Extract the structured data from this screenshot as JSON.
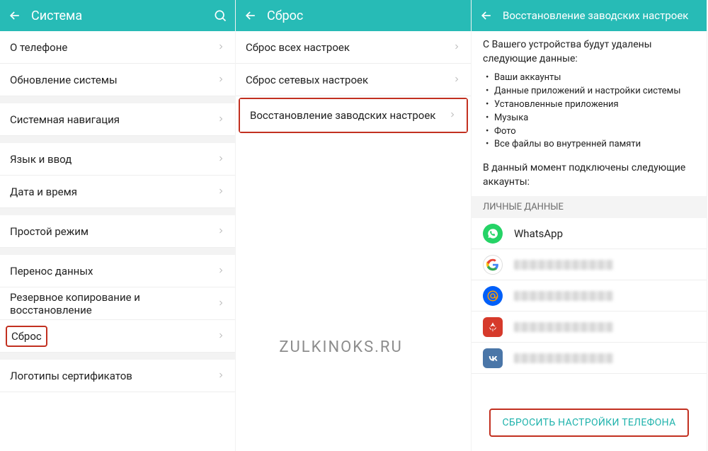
{
  "watermark": "ZULKINOKS.RU",
  "panel1": {
    "title": "Система",
    "groups": [
      [
        "О телефоне",
        "Обновление системы"
      ],
      [
        "Системная навигация"
      ],
      [
        "Язык и ввод",
        "Дата и время"
      ],
      [
        "Простой режим"
      ],
      [
        "Перенос данных",
        "Резервное копирование и восстановление",
        "Сброс"
      ],
      [
        "Логотипы сертификатов"
      ]
    ],
    "highlighted": "Сброс"
  },
  "panel2": {
    "title": "Сброс",
    "items": [
      "Сброс всех настроек",
      "Сброс сетевых настроек",
      "Восстановление заводских настроек"
    ],
    "highlighted": "Восстановление заводских настроек"
  },
  "panel3": {
    "title": "Восстановление заводских настроек",
    "intro": "С Вашего устройства будут удалены следующие данные:",
    "bullets": [
      "Ваши аккаунты",
      "Данные приложений и настройки системы",
      "Установленные приложения",
      "Музыка",
      "Фото",
      "Все файлы во внутренней памяти"
    ],
    "accountsIntro": "В данный момент подключены следующие аккаунты:",
    "sectionLabel": "ЛИЧНЫЕ ДАННЫЕ",
    "accounts": [
      {
        "kind": "whatsapp",
        "label": "WhatsApp"
      },
      {
        "kind": "google",
        "label": ""
      },
      {
        "kind": "mailru",
        "label": ""
      },
      {
        "kind": "huawei",
        "label": ""
      },
      {
        "kind": "vk",
        "label": ""
      }
    ],
    "resetButton": "СБРОСИТЬ НАСТРОЙКИ ТЕЛЕФОНА"
  }
}
